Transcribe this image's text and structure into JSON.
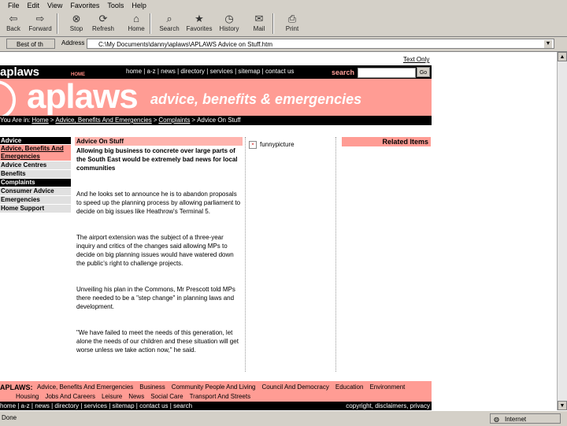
{
  "browser": {
    "menu": [
      "File",
      "Edit",
      "View",
      "Favorites",
      "Tools",
      "Help"
    ],
    "toolbar": [
      {
        "label": "Back",
        "icon": "back-arrow-icon",
        "glyph": "⇦"
      },
      {
        "label": "Forward",
        "icon": "forward-arrow-icon",
        "glyph": "⇨"
      },
      {
        "label": "Stop",
        "icon": "stop-icon",
        "glyph": "⊗"
      },
      {
        "label": "Refresh",
        "icon": "refresh-icon",
        "glyph": "⟳"
      },
      {
        "label": "Home",
        "icon": "home-icon",
        "glyph": "⌂"
      },
      {
        "label": "Search",
        "icon": "search-icon",
        "glyph": "⌕"
      },
      {
        "label": "Favorites",
        "icon": "favorites-icon",
        "glyph": "★"
      },
      {
        "label": "History",
        "icon": "history-icon",
        "glyph": "◷"
      },
      {
        "label": "Mail",
        "icon": "mail-icon",
        "glyph": "✉"
      },
      {
        "label": "Print",
        "icon": "print-icon",
        "glyph": "⎙"
      }
    ],
    "links_label": "Best of th",
    "address_label": "Address",
    "address_value": "C:\\My Documents\\danny\\aplaws\\APLAWS Advice on Stuff.htm",
    "status_text": "Done",
    "status_zone": "Internet"
  },
  "page": {
    "text_only": "Text Only",
    "logo_small": "aplaws",
    "home_tab": "HOME",
    "nav_links": "home | a-z | news | directory | services | sitemap | contact us",
    "search_label": "search",
    "go_label": "Go",
    "banner_word": "aplaws",
    "banner_tagline": "advice, benefits & emergencies",
    "breadcrumb_prefix": "You Are in:",
    "breadcrumb": [
      "Home",
      "Advice, Benefits And Emergencies",
      "Complaints",
      "Advice On Stuff"
    ],
    "sidebar": [
      {
        "label": "Advice",
        "style": "black"
      },
      {
        "label": "Advice, Benefits And Emergencies",
        "style": "pink"
      },
      {
        "label": "Advice Centres",
        "style": "grey"
      },
      {
        "label": "Benefits",
        "style": "grey"
      },
      {
        "label": "Complaints",
        "style": "black"
      },
      {
        "label": "Consumer Advice",
        "style": "grey"
      },
      {
        "label": "Emergencies",
        "style": "grey"
      },
      {
        "label": "Home Support",
        "style": "grey"
      }
    ],
    "article": {
      "title": "Advice On Stuff",
      "lead": "Allowing big business to concrete over large parts of the South East would be extremely bad news for local communities",
      "paragraphs": [
        "And he looks set to announce he is to abandon proposals to speed up the planning process by allowing parliament to decide on big issues like Heathrow's Terminal 5.",
        "The airport extension was the subject of a three-year inquiry and critics of the changes said allowing MPs to decide on big planning issues would have watered down the public's right to challenge projects.",
        "Unveiling his plan in the Commons, Mr Prescott told MPs there needed to be a \"step change\" in planning laws and development.",
        "\"We have failed to meet the needs of this generation, let alone the needs of our children and these situation will get worse unless we take action now,\" he said."
      ]
    },
    "related_image_alt": "funnypicture",
    "related_heading": "Related Items",
    "footer": {
      "brand": "APLAWS:",
      "row1": [
        "Advice, Benefits And Emergencies",
        "Business",
        "Community People And Living",
        "Council And Democracy",
        "Education",
        "Environment"
      ],
      "row2": [
        "Housing",
        "Jobs And Careers",
        "Leisure",
        "News",
        "Social Care",
        "Transport And Streets"
      ],
      "bottom_links": [
        "home",
        "a-z",
        "news",
        "directory",
        "services",
        "sitemap",
        "contact us",
        "search"
      ],
      "copyright": "copyright, disclaimers, privacy"
    }
  }
}
